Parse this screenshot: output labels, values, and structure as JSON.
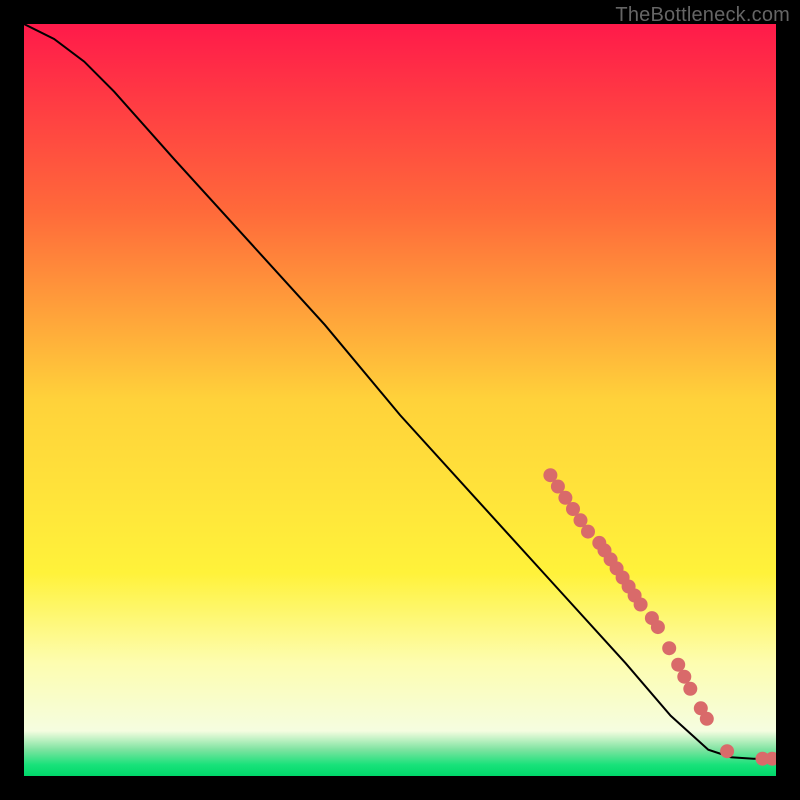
{
  "attribution": "TheBottleneck.com",
  "chart_data": {
    "type": "line",
    "title": "",
    "xlabel": "",
    "ylabel": "",
    "xlim": [
      0,
      100
    ],
    "ylim": [
      0,
      100
    ],
    "gradient_stops": [
      {
        "t": 0.0,
        "color": "#ff1a4a"
      },
      {
        "t": 0.25,
        "color": "#ff6a3a"
      },
      {
        "t": 0.5,
        "color": "#ffd23a"
      },
      {
        "t": 0.73,
        "color": "#fff23a"
      },
      {
        "t": 0.85,
        "color": "#fdfdb0"
      },
      {
        "t": 0.94,
        "color": "#f5fde0"
      },
      {
        "t": 0.965,
        "color": "#7de3a0"
      },
      {
        "t": 0.985,
        "color": "#19e27a"
      },
      {
        "t": 1.0,
        "color": "#00d86a"
      }
    ],
    "curve": [
      {
        "x": 0,
        "y": 100
      },
      {
        "x": 4,
        "y": 98
      },
      {
        "x": 8,
        "y": 95
      },
      {
        "x": 12,
        "y": 91
      },
      {
        "x": 20,
        "y": 82
      },
      {
        "x": 30,
        "y": 71
      },
      {
        "x": 40,
        "y": 60
      },
      {
        "x": 50,
        "y": 48
      },
      {
        "x": 60,
        "y": 37
      },
      {
        "x": 70,
        "y": 26
      },
      {
        "x": 80,
        "y": 15
      },
      {
        "x": 86,
        "y": 8
      },
      {
        "x": 91,
        "y": 3.5
      },
      {
        "x": 94,
        "y": 2.5
      },
      {
        "x": 97,
        "y": 2.3
      },
      {
        "x": 100,
        "y": 2.3
      }
    ],
    "points": {
      "color": "#d96a6a",
      "radius": 7,
      "xy": [
        [
          70,
          40
        ],
        [
          71,
          38.5
        ],
        [
          72,
          37
        ],
        [
          73,
          35.5
        ],
        [
          74,
          34
        ],
        [
          75,
          32.5
        ],
        [
          76.5,
          31
        ],
        [
          77.2,
          30
        ],
        [
          78,
          28.8
        ],
        [
          78.8,
          27.6
        ],
        [
          79.6,
          26.4
        ],
        [
          80.4,
          25.2
        ],
        [
          81.2,
          24
        ],
        [
          82,
          22.8
        ],
        [
          83.5,
          21
        ],
        [
          84.3,
          19.8
        ],
        [
          85.8,
          17
        ],
        [
          87,
          14.8
        ],
        [
          87.8,
          13.2
        ],
        [
          88.6,
          11.6
        ],
        [
          90,
          9
        ],
        [
          90.8,
          7.6
        ],
        [
          93.5,
          3.3
        ],
        [
          98.2,
          2.3
        ],
        [
          99.5,
          2.3
        ]
      ]
    }
  }
}
